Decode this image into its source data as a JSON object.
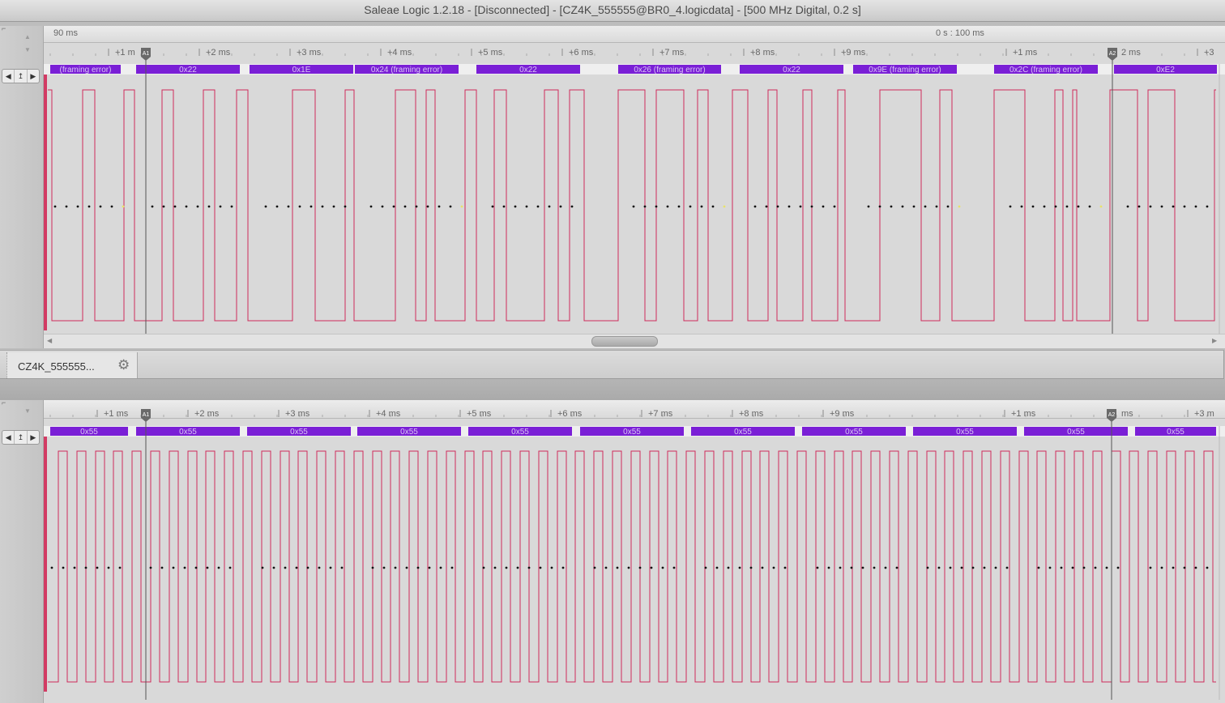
{
  "window": {
    "title": "Saleae Logic 1.2.18 - [Disconnected] - [CZ4K_555555@BR0_4.logicdata] - [500 MHz Digital, 0.2 s]"
  },
  "top_panel": {
    "ruler": {
      "start_label": "90 ms",
      "scale_label": "0 s : 100 ms",
      "ticks": [
        "+1 m",
        "+2 ms",
        "+3 ms",
        "+4 ms",
        "+5 ms",
        "+6 ms",
        "+7 ms",
        "+8 ms",
        "+9 ms",
        "+1 ms",
        "2 ms",
        "+3"
      ]
    },
    "markers": {
      "a1": "A1",
      "a2": "A2"
    },
    "decodes": [
      "(framing error)",
      "0x22",
      "0x1E",
      "0x24 (framing error)",
      "0x22",
      "0x26 (framing error)",
      "0x22",
      "0x9E (framing error)",
      "0x2C (framing error)",
      "0xE2"
    ]
  },
  "bottom_panel": {
    "ruler": {
      "ticks": [
        "+1 ms",
        "+2 ms",
        "+3 ms",
        "+4 ms",
        "+5 ms",
        "+6 ms",
        "+7 ms",
        "+8 ms",
        "+9 ms",
        "+1 ms",
        "ms",
        "+3 m"
      ]
    },
    "markers": {
      "a1": "A1",
      "a2": "A2"
    },
    "decodes": [
      "0x55",
      "0x55",
      "0x55",
      "0x55",
      "0x55",
      "0x55",
      "0x55",
      "0x55",
      "0x55",
      "0x55",
      "0x55"
    ]
  },
  "tab": {
    "label": "CZ4K_555555...",
    "settings_icon": "gear-icon"
  },
  "sidebar": {
    "nav_left": "◀",
    "nav_edge": "↥",
    "nav_right": "▶"
  },
  "colors": {
    "decode_bar": "#7a1fd6",
    "signal": "#cf2a5a",
    "sample_dot": "#111111",
    "error_dot": "#e8e26a"
  }
}
